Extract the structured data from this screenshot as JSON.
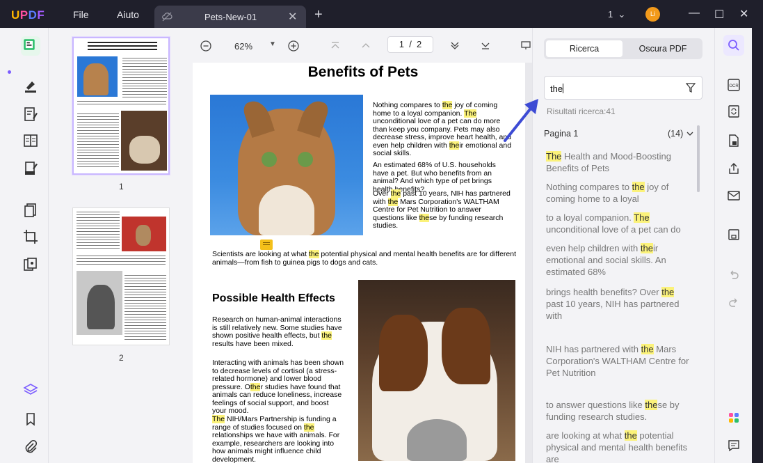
{
  "app": {
    "logo": "UPDF"
  },
  "menu": {
    "file": "File",
    "help": "Aiuto"
  },
  "tab": {
    "title": "Pets-New-01"
  },
  "titlebar": {
    "page_indicator": "1",
    "avatar_initials": "Li"
  },
  "thumbnails": {
    "page1_number": "1",
    "page2_number": "2"
  },
  "viewer": {
    "zoom": "62%",
    "current_page": "1",
    "total_pages": "2",
    "page_separator": "/"
  },
  "document": {
    "title": "Benefits of Pets",
    "p1": [
      "Nothing compares to ",
      "the",
      " joy of coming home to a loyal companion. ",
      "The",
      " unconditional love of a pet can do more than keep you company. Pets may also decrease stress, improve heart health,  and  even  help children  with  ",
      "the",
      "ir emotional and social skills."
    ],
    "p2": [
      "An estimated 68% of U.S. households have a pet. But who benefits from an animal? And which type of pet brings health benefits?"
    ],
    "p3": [
      "Over  ",
      "the",
      "  past  10  years,  NIH  has partnered  with  ",
      "the",
      " Mars Corporation's WALTHAM Centre for  Pet  Nutrition  to answer  questions  like  ",
      "the",
      "se  by  funding research studies."
    ],
    "p4": [
      "Scientists are looking at what ",
      "the",
      " potential physical and mental health benefits are for different animals—from fish to guinea pigs to dogs and cats."
    ],
    "heading2": "Possible Health Effects",
    "p5": [
      "Research  on  human-animal  interactions is still  relatively  new.  Some  studies  have shown  positive  health  effects,  but  ",
      "the",
      " results have been mixed."
    ],
    "p6": [
      "Interacting with animals has been shown to decrease levels of cortisol (a stress-related hormone) and lower blood pressure. O",
      "the",
      "r studies have found that animals can reduce loneliness,  increase  feelings  of social support, and boost your mood."
    ],
    "p7": [
      "The",
      " NIH/Mars Partnership is funding a range  of  studies  focused  on  ",
      "the",
      " relationships  we  have  with  animals.  For example, researchers are looking into how animals might influence child development."
    ]
  },
  "search": {
    "tab_search": "Ricerca",
    "tab_redact": "Oscura PDF",
    "query": "the",
    "results_label": "Risultati ricerca:41",
    "page_group": "Pagina 1",
    "page_count": "(14)",
    "results": [
      [
        "",
        "The",
        " Health and Mood-Boosting Benefits of Pets"
      ],
      [
        "Nothing compares to ",
        "the",
        " joy of coming home to a loyal"
      ],
      [
        "to a loyal companion. ",
        "The",
        " unconditional love of a pet can do"
      ],
      [
        "even help children with ",
        "the",
        "ir emotional and social skills. An estimated 68%"
      ],
      [
        "brings health benefits? Over ",
        "the",
        " past 10 years, NIH has partnered with"
      ],
      [
        "NIH has partnered with ",
        "the",
        " Mars Corporation's WALTHAM Centre for Pet Nutrition"
      ],
      [
        "to answer questions like ",
        "the",
        "se by funding research studies."
      ],
      [
        "are looking at what ",
        "the",
        " potential physical and mental health benefits are"
      ]
    ]
  },
  "colors": {
    "highlight": "#fbf27a",
    "accent": "#7b5cff",
    "arrow": "#3d4bd4"
  }
}
